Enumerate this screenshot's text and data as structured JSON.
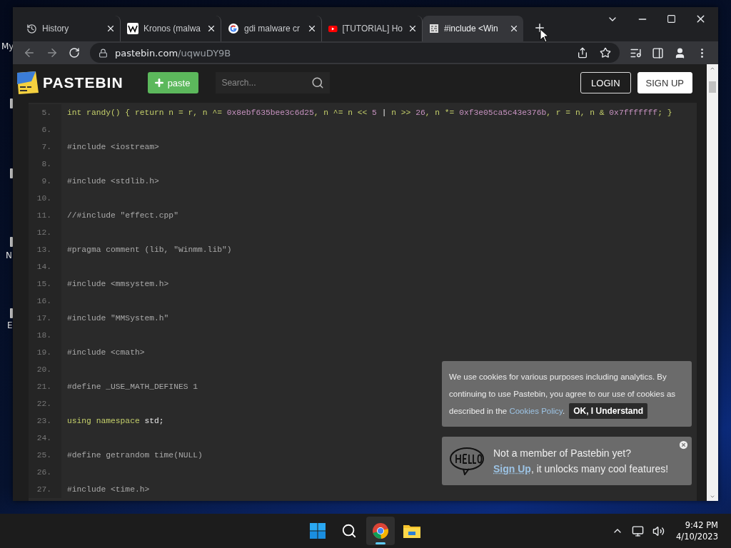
{
  "desktop": {
    "labels": [
      "My",
      "N",
      "E"
    ]
  },
  "tabs": [
    {
      "kind": "history",
      "title": "History",
      "selected": false
    },
    {
      "kind": "wiki",
      "title": "Kronos (malwa",
      "selected": false
    },
    {
      "kind": "google",
      "title": "gdi malware cr",
      "selected": false
    },
    {
      "kind": "youtube",
      "title": "[TUTORIAL] Ho",
      "selected": false
    },
    {
      "kind": "pastebin",
      "title": "#include <Win",
      "selected": true
    }
  ],
  "address": {
    "host": "pastebin.com",
    "path": "/uqwuDY9B"
  },
  "site_header": {
    "logo": "PASTEBIN",
    "paste_button": "paste",
    "search": {
      "placeholder": "Search..."
    },
    "login": "LOGIN",
    "signup": "SIGN UP"
  },
  "code": {
    "lines": [
      {
        "number": "5.",
        "tokens": [
          {
            "kind": "keyword",
            "text": "int randy() { return n = r, n ^= "
          },
          {
            "kind": "number",
            "text": "0x8ebf635bee3c6d25"
          },
          {
            "kind": "keyword",
            "text": ", n ^= n << "
          },
          {
            "kind": "number",
            "text": "5"
          },
          {
            "kind": "symbol",
            "text": " | "
          },
          {
            "kind": "keyword",
            "text": "n >> "
          },
          {
            "kind": "number",
            "text": "26"
          },
          {
            "kind": "keyword",
            "text": ", n *= "
          },
          {
            "kind": "number",
            "text": "0xf3e05ca5c43e376b"
          },
          {
            "kind": "keyword",
            "text": ", r = n, n & "
          },
          {
            "kind": "number",
            "text": "0x7fffffff"
          },
          {
            "kind": "keyword",
            "text": "; }"
          }
        ]
      },
      {
        "number": "6."
      },
      {
        "number": "7.",
        "tokens": [
          {
            "kind": "text",
            "text": "#include <iostream>"
          }
        ]
      },
      {
        "number": "8."
      },
      {
        "number": "9.",
        "tokens": [
          {
            "kind": "text",
            "text": "#include <stdlib.h>"
          }
        ]
      },
      {
        "number": "10."
      },
      {
        "number": "11.",
        "tokens": [
          {
            "kind": "text",
            "text": "//#include \"effect.cpp\""
          }
        ]
      },
      {
        "number": "12."
      },
      {
        "number": "13.",
        "tokens": [
          {
            "kind": "text",
            "text": "#pragma comment (lib, \"Winmm.lib\")"
          }
        ]
      },
      {
        "number": "14."
      },
      {
        "number": "15.",
        "tokens": [
          {
            "kind": "text",
            "text": "#include <mmsystem.h>"
          }
        ]
      },
      {
        "number": "16."
      },
      {
        "number": "17.",
        "tokens": [
          {
            "kind": "text",
            "text": "#include \"MMSystem.h\""
          }
        ]
      },
      {
        "number": "18."
      },
      {
        "number": "19.",
        "tokens": [
          {
            "kind": "text",
            "text": "#include <cmath>"
          }
        ]
      },
      {
        "number": "20."
      },
      {
        "number": "21.",
        "tokens": [
          {
            "kind": "text",
            "text": "#define _USE_MATH_DEFINES 1"
          }
        ]
      },
      {
        "number": "22."
      },
      {
        "number": "23.",
        "tokens": [
          {
            "kind": "keyword",
            "text": "using namespace "
          },
          {
            "kind": "symbol",
            "text": "std;"
          }
        ]
      },
      {
        "number": "24."
      },
      {
        "number": "25.",
        "tokens": [
          {
            "kind": "text",
            "text": "#define getrandom time(NULL)"
          }
        ]
      },
      {
        "number": "26."
      },
      {
        "number": "27.",
        "tokens": [
          {
            "kind": "text",
            "text": "#include <time.h>"
          }
        ]
      }
    ]
  },
  "cookie_notice": {
    "text": "We use cookies for various purposes including analytics. By continuing to use Pastebin, you agree to our use of cookies as",
    "text_2": "described in the ",
    "link": "Cookies Policy",
    "end": ".",
    "button": "OK, I Understand"
  },
  "signup_prompt": {
    "title": "Not a member of Pastebin yet?",
    "link": "Sign Up",
    "text": ", it unlocks many cool features!"
  },
  "taskbar": {
    "apps": [
      {
        "kind": "start",
        "selected": false
      },
      {
        "kind": "search",
        "selected": false
      },
      {
        "kind": "chrome",
        "selected": true
      },
      {
        "kind": "files",
        "selected": false
      }
    ],
    "time": "9:42 PM",
    "date": "4/10/2023"
  }
}
